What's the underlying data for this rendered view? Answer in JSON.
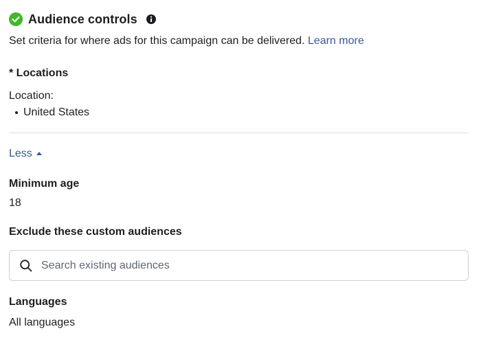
{
  "header": {
    "title": "Audience controls",
    "status_icon": "check-circle-icon",
    "info_icon": "info-icon"
  },
  "subtitle": {
    "text": "Set criteria for where ads for this campaign can be delivered.",
    "link": "Learn more"
  },
  "locations": {
    "label": "* Locations",
    "field_label": "Location:",
    "items": [
      "United States"
    ]
  },
  "toggle": {
    "label": "Less",
    "icon": "caret-up-icon"
  },
  "minimum_age": {
    "label": "Minimum age",
    "value": "18"
  },
  "exclude": {
    "label": "Exclude these custom audiences",
    "search_placeholder": "Search existing audiences",
    "search_value": ""
  },
  "languages": {
    "label": "Languages",
    "value": "All languages"
  },
  "colors": {
    "success": "#42b72a",
    "link": "#385898",
    "text": "#1c1e21",
    "divider": "#dadde1",
    "input_border": "#ccd0d5"
  }
}
